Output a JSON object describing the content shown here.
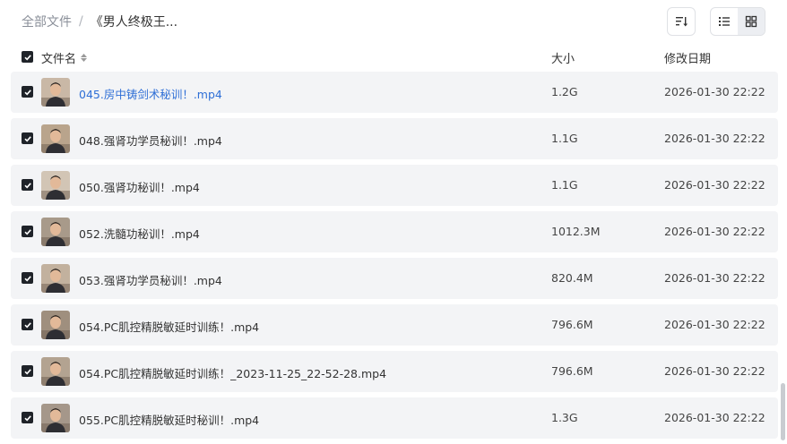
{
  "breadcrumb": {
    "root": "全部文件",
    "separator": "/",
    "current": "《男人终极王..."
  },
  "toolbar": {
    "sort_icon": "sort-icon",
    "list_view_icon": "list-view-icon",
    "grid_view_icon": "grid-view-icon",
    "active_view": "list"
  },
  "columns": {
    "name": "文件名",
    "size": "大小",
    "modified": "修改日期"
  },
  "files": [
    {
      "name": "045.房中铸剑术秘训！.mp4",
      "size": "1.2G",
      "modified": "2026-01-30 22:22",
      "highlighted": true,
      "checked": true
    },
    {
      "name": "048.强肾功学员秘训！.mp4",
      "size": "1.1G",
      "modified": "2026-01-30 22:22",
      "highlighted": false,
      "checked": true
    },
    {
      "name": "050.强肾功秘训！.mp4",
      "size": "1.1G",
      "modified": "2026-01-30 22:22",
      "highlighted": false,
      "checked": true
    },
    {
      "name": "052.洗髓功秘训！.mp4",
      "size": "1012.3M",
      "modified": "2026-01-30 22:22",
      "highlighted": false,
      "checked": true
    },
    {
      "name": "053.强肾功学员秘训！.mp4",
      "size": "820.4M",
      "modified": "2026-01-30 22:22",
      "highlighted": false,
      "checked": true
    },
    {
      "name": "054.PC肌控精脱敏延时训练！.mp4",
      "size": "796.6M",
      "modified": "2026-01-30 22:22",
      "highlighted": false,
      "checked": true
    },
    {
      "name": "054.PC肌控精脱敏延时训练！_2023-11-25_22-52-28.mp4",
      "size": "796.6M",
      "modified": "2026-01-30 22:22",
      "highlighted": false,
      "checked": true
    },
    {
      "name": "055.PC肌控精脱敏延时秘训！.mp4",
      "size": "1.3G",
      "modified": "2026-01-30 22:22",
      "highlighted": false,
      "checked": true
    }
  ],
  "colors": {
    "link": "#2f6fd6",
    "row_bg": "#f3f4f6",
    "checkbox": "#1f2329"
  }
}
